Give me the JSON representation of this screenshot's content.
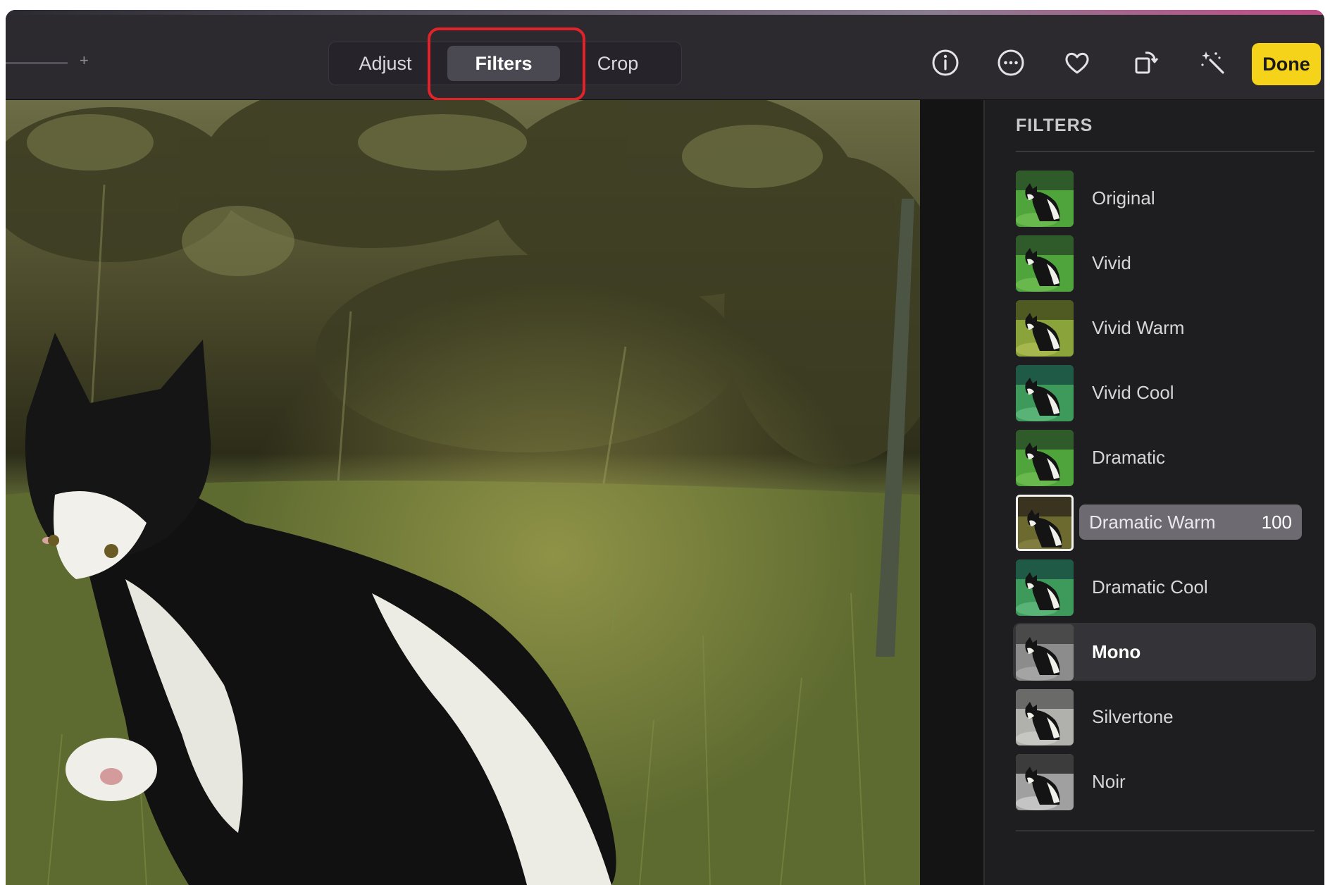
{
  "toolbar": {
    "zoom_plus": "+",
    "tabs": [
      {
        "label": "Adjust",
        "selected": false
      },
      {
        "label": "Filters",
        "selected": true
      },
      {
        "label": "Crop",
        "selected": false
      }
    ],
    "icons": [
      "info-icon",
      "more-icon",
      "heart-icon",
      "rotate-icon",
      "magic-wand-icon"
    ],
    "done_label": "Done",
    "done_color": "#f5d31b",
    "highlight_color": "#e0242a"
  },
  "sidebar": {
    "title": "FILTERS",
    "filters": [
      {
        "label": "Original",
        "tint": "vivid"
      },
      {
        "label": "Vivid",
        "tint": "vivid"
      },
      {
        "label": "Vivid Warm",
        "tint": "warm"
      },
      {
        "label": "Vivid Cool",
        "tint": "cool"
      },
      {
        "label": "Dramatic",
        "tint": "vivid"
      },
      {
        "label": "Dramatic Warm",
        "tint": "dramwarm",
        "selected": true,
        "value": "100"
      },
      {
        "label": "Dramatic Cool",
        "tint": "cool"
      },
      {
        "label": "Mono",
        "tint": "mono",
        "hovered": true
      },
      {
        "label": "Silvertone",
        "tint": "silver"
      },
      {
        "label": "Noir",
        "tint": "noir"
      }
    ]
  }
}
